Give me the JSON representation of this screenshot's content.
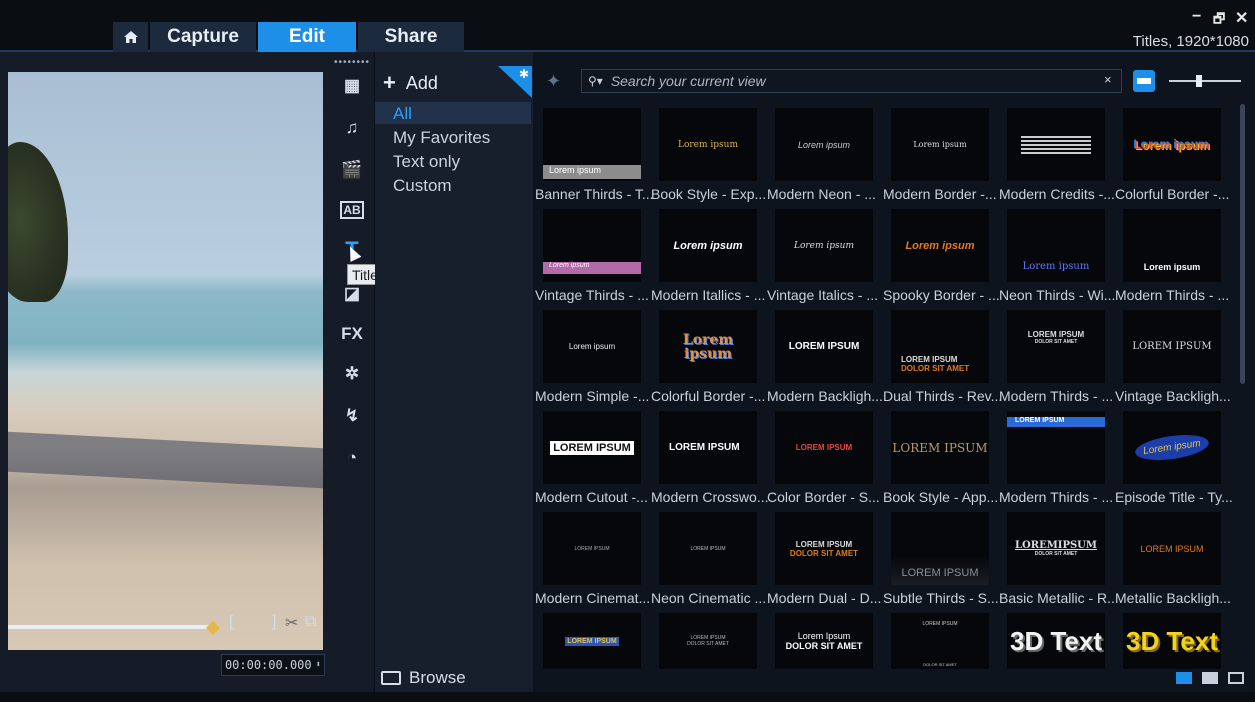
{
  "tabs": {
    "capture": "Capture",
    "edit": "Edit",
    "share": "Share"
  },
  "window": {
    "minimize": "−",
    "restore": "🗗",
    "close": "✕"
  },
  "project_info": "Titles, 1920*1080",
  "preview": {
    "timecode": "00:00:00.000",
    "mark_in": "[",
    "mark_out": "]"
  },
  "rail": {
    "grip": "••••••••",
    "tooltip": "Titles",
    "fx_label": "FX"
  },
  "categories": {
    "add_label": "Add",
    "items": [
      "All",
      "My Favorites",
      "Text only",
      "Custom"
    ],
    "selected": "All",
    "browse_label": "Browse"
  },
  "library": {
    "search_placeholder": "Search your current view",
    "clear": "×",
    "thumbnails": [
      [
        "Banner Thirds - T...",
        "Book Style - Exp...",
        "Modern Neon - ...",
        "Modern Border -...",
        "Modern Credits -...",
        "Colorful Border -..."
      ],
      [
        "Vintage Thirds - ...",
        "Modern Itallics - ...",
        "Vintage Italics - ...",
        "Spooky Border - ...",
        "Neon Thirds - Wi...",
        "Modern Thirds - ..."
      ],
      [
        "Modern Simple -...",
        "Colorful Border -...",
        "Modern Backligh...",
        "Dual Thirds - Rev...",
        "Modern Thirds - ...",
        "Vintage Backligh..."
      ],
      [
        "Modern Cutout -...",
        "Modern Crosswo...",
        "Color Border - S...",
        "Book Style - App...",
        "Modern Thirds - ...",
        "Episode Title - Ty..."
      ],
      [
        "Modern Cinemat...",
        "Neon Cinematic ...",
        "Modern Dual - D...",
        "Subtle Thirds - S...",
        "Basic Metallic - R...",
        "Metallic Backligh..."
      ]
    ],
    "thumb_text": {
      "lorem": "Lorem ipsum",
      "lorem_caps": "LOREM IPSUM",
      "lorem_caps_spaced": "LOREMIPSUM",
      "dolor": "DOLOR SIT AMET",
      "lorem_ipsum_title": "Lorem Ipsum",
      "text3d": "3D Text"
    }
  }
}
